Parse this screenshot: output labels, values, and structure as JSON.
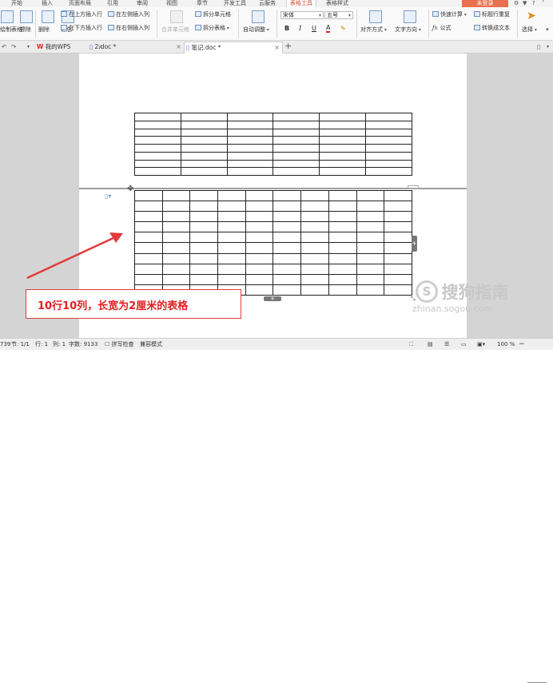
{
  "menu": {
    "tabs": [
      "开始",
      "插入",
      "页面布局",
      "引用",
      "审阅",
      "视图",
      "章节",
      "开发工具",
      "云服务",
      "表格工具",
      "表格样式"
    ],
    "active_tab": "表格工具",
    "login_label": "未登录"
  },
  "ribbon": {
    "draw_table": "绘制表格",
    "erase": "擦除",
    "delete": "删除",
    "summary": "汇总",
    "insert_above": "在上方插入行",
    "insert_below": "在下方插入行",
    "insert_left": "在左侧插入列",
    "insert_right": "在右侧插入列",
    "merge_cells": "合并单元格",
    "split_cells": "拆分单元格",
    "split_table": "拆分表格",
    "autofit": "自动调整",
    "font_name": "宋体",
    "font_size": "五号",
    "bold": "B",
    "italic": "I",
    "underline": "U",
    "font_color": "A",
    "align": "对齐方式",
    "text_direction": "文字方向",
    "quick_calc": "快速计算",
    "header_repeat": "标题行重复",
    "formula": "公式",
    "to_text": "转换成文本",
    "select": "选择"
  },
  "doc_tabs": [
    {
      "label": "我的WPS",
      "active": false
    },
    {
      "label": "2.doc *",
      "active": false
    },
    {
      "label": "笔记.doc *",
      "active": true
    }
  ],
  "annotation": {
    "text": "10行10列，长宽为2厘米的表格"
  },
  "watermark": {
    "brand": "搜狗指南",
    "url": "zhinan.sogou.com"
  },
  "status": {
    "page_count": "739",
    "section": "节: 1/1",
    "line": "行: 1",
    "column": "列: 1",
    "word_count": "字数: 9133",
    "spell_check": "拼写检查",
    "compat_mode": "兼容模式",
    "zoom": "100 %"
  },
  "colors": {
    "accent": "#d24726",
    "login": "#e8704f",
    "annotation": "#e02020"
  }
}
